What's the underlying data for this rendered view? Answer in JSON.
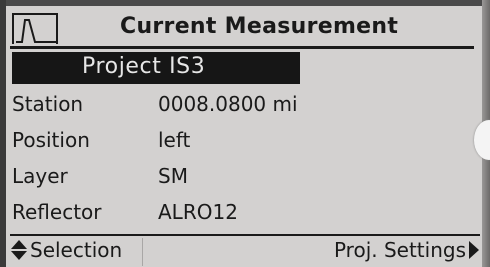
{
  "header": {
    "title": "Current Measurement",
    "icon": "signal-waveform-icon"
  },
  "project": {
    "name": "Project IS3"
  },
  "fields": [
    {
      "label": "Station",
      "value": "0008.0800 mi"
    },
    {
      "label": "Position",
      "value": "left"
    },
    {
      "label": "Layer",
      "value": "SM"
    },
    {
      "label": "Reflector",
      "value": "ALRO12"
    }
  ],
  "footer": {
    "left_label": "Selection",
    "left_icon": "up-down-arrows-icon",
    "right_label": "Proj. Settings",
    "right_icon": "right-arrow-icon"
  },
  "colors": {
    "screen_background": "#d3d1d0",
    "text": "#1a1a1a",
    "highlight_background": "#161616",
    "highlight_text": "#e6e6e6"
  }
}
